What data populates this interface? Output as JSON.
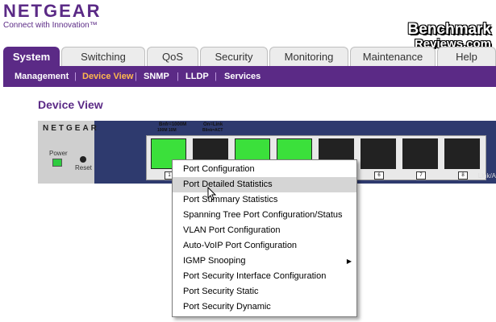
{
  "logo": {
    "name": "NETGEAR",
    "tagline": "Connect with Innovation™"
  },
  "watermark": {
    "line1": "Benchmark",
    "line2": "Reviews.com"
  },
  "tabs": [
    {
      "label": "System",
      "active": true
    },
    {
      "label": "Switching",
      "active": false
    },
    {
      "label": "QoS",
      "active": false
    },
    {
      "label": "Security",
      "active": false
    },
    {
      "label": "Monitoring",
      "active": false
    },
    {
      "label": "Maintenance",
      "active": false
    },
    {
      "label": "Help",
      "active": false
    }
  ],
  "subnav": [
    {
      "label": "Management",
      "active": false
    },
    {
      "label": "Device View",
      "active": true
    },
    {
      "label": "SNMP",
      "active": false
    },
    {
      "label": "LLDP",
      "active": false
    },
    {
      "label": "Services",
      "active": false
    }
  ],
  "page_title": "Device View",
  "device": {
    "brand": "NETGEAR",
    "power_label": "Power",
    "reset_label": "Reset",
    "link_label": "Link/A",
    "legend_speed": "Bnfr=1000M",
    "legend_speed_sub": "100M 10M",
    "legend_link": "On=Link",
    "legend_link_sub": "Blink=ACT",
    "ports": [
      {
        "num": "1",
        "state": "green"
      },
      {
        "num": "2",
        "state": "black"
      },
      {
        "num": "3",
        "state": "green"
      },
      {
        "num": "4",
        "state": "green"
      },
      {
        "num": "5",
        "state": "black"
      },
      {
        "num": "6",
        "state": "black"
      },
      {
        "num": "7",
        "state": "black"
      },
      {
        "num": "8",
        "state": "black"
      }
    ]
  },
  "context_menu": {
    "items": [
      {
        "label": "Port Configuration"
      },
      {
        "label": "Port Detailed Statistics",
        "hovered": true
      },
      {
        "label": "Port Summary Statistics"
      },
      {
        "label": "Spanning Tree Port Configuration/Status"
      },
      {
        "label": "VLAN Port Configuration"
      },
      {
        "label": "Auto-VoIP Port Configuration"
      },
      {
        "label": "IGMP Snooping",
        "submenu": true
      },
      {
        "label": "Port Security Interface Configuration"
      },
      {
        "label": "Port Security Static"
      },
      {
        "label": "Port Security Dynamic"
      }
    ]
  },
  "colors": {
    "brand_purple": "#5b2a86",
    "active_subnav": "#ffb84d",
    "port_green": "#3be03b"
  }
}
